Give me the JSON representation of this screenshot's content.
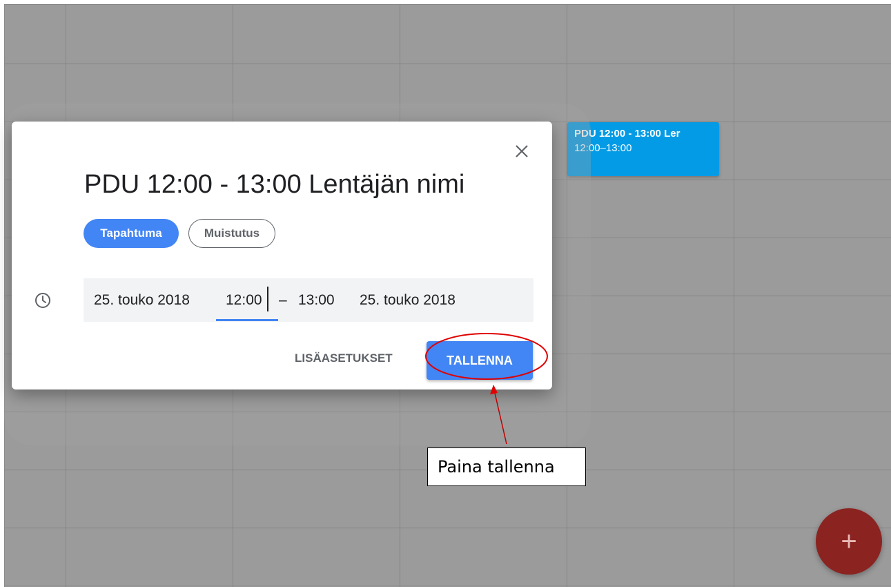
{
  "event_chip": {
    "title": "PDU 12:00 - 13:00 Ler",
    "time": "12:00–13:00",
    "color": "#039be5"
  },
  "dialog": {
    "title": "PDU 12:00 - 13:00 Lentäjän nimi",
    "close_icon": "close-icon",
    "tabs": [
      {
        "label": "Tapahtuma",
        "selected": true
      },
      {
        "label": "Muistutus",
        "selected": false
      }
    ],
    "time_row": {
      "icon": "clock-icon",
      "start_date": "25. touko 2018",
      "start_time": "12:00",
      "dash": "–",
      "end_time": "13:00",
      "end_date": "25. touko 2018"
    },
    "more_options_label": "LISÄASETUKSET",
    "save_label": "TALLENNA",
    "accent_color": "#4285f4"
  },
  "annotation": {
    "text": "Paina tallenna",
    "color": "#e00000"
  },
  "fab": {
    "label": "+",
    "icon": "plus-icon",
    "color": "#8b2320"
  }
}
